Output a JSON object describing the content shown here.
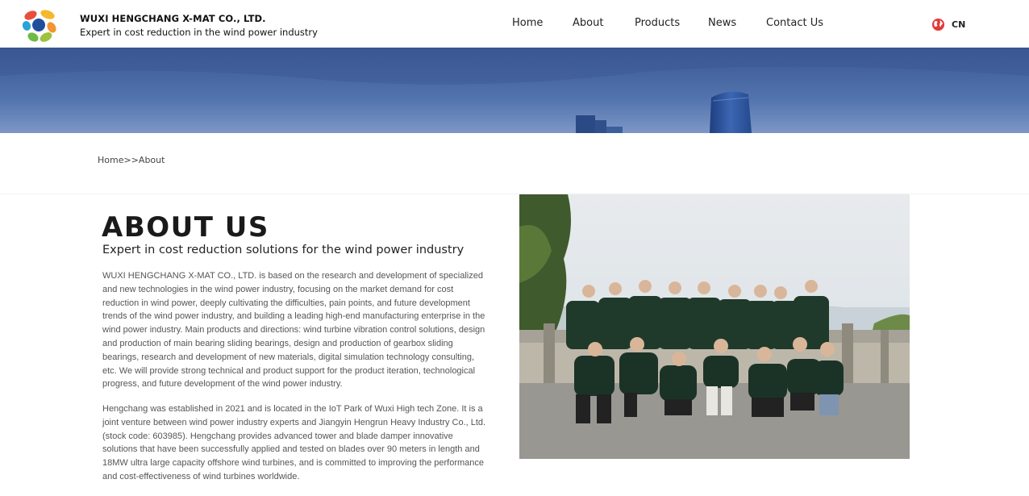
{
  "header": {
    "company_name": "WUXI HENGCHANG X-MAT CO., LTD.",
    "tagline": "Expert in cost reduction in the wind power industry",
    "logo_icon": "flower-logo-icon",
    "nav": [
      {
        "label": "Home"
      },
      {
        "label": "About"
      },
      {
        "label": "Products"
      },
      {
        "label": "News"
      },
      {
        "label": "Contact Us"
      }
    ],
    "language": {
      "label": "CN",
      "icon": "globe-icon"
    }
  },
  "breadcrumb": {
    "home": "Home",
    "separator": ">>",
    "current": "About"
  },
  "about": {
    "title": "ABOUT US",
    "subtitle": "Expert in cost reduction solutions for the wind power industry",
    "paragraph1": "WUXI HENGCHANG X-MAT CO., LTD. is based on the research and development of specialized and new technologies in the wind power industry, focusing on the market demand for cost reduction in wind power, deeply cultivating the difficulties, pain points, and future development trends of the wind power industry, and building a leading high-end manufacturing enterprise in the wind power industry. Main products and directions: wind turbine vibration control solutions, design and production of main bearing sliding bearings, design and production of gearbox sliding bearings, research and development of new materials, digital simulation technology consulting, etc. We will provide strong technical and product support for the product iteration, technological progress, and future development of the wind power industry.",
    "paragraph2": "Hengchang was established in 2021 and is located in the IoT Park of Wuxi High tech Zone. It is a joint venture between wind power industry experts and Jiangyin Hengrun Heavy Industry Co., Ltd. (stock code: 603985). Hengchang provides advanced tower and blade damper innovative solutions that have been successfully applied and tested on blades over 90 meters in length and 18MW ultra large capacity offshore wind turbines, and is committed to improving the performance and cost-effectiveness of wind turbines worldwide."
  },
  "colors": {
    "banner_sky": "#4a6aa6",
    "shirt_green": "#1f3a2a",
    "text_body": "#555555"
  }
}
